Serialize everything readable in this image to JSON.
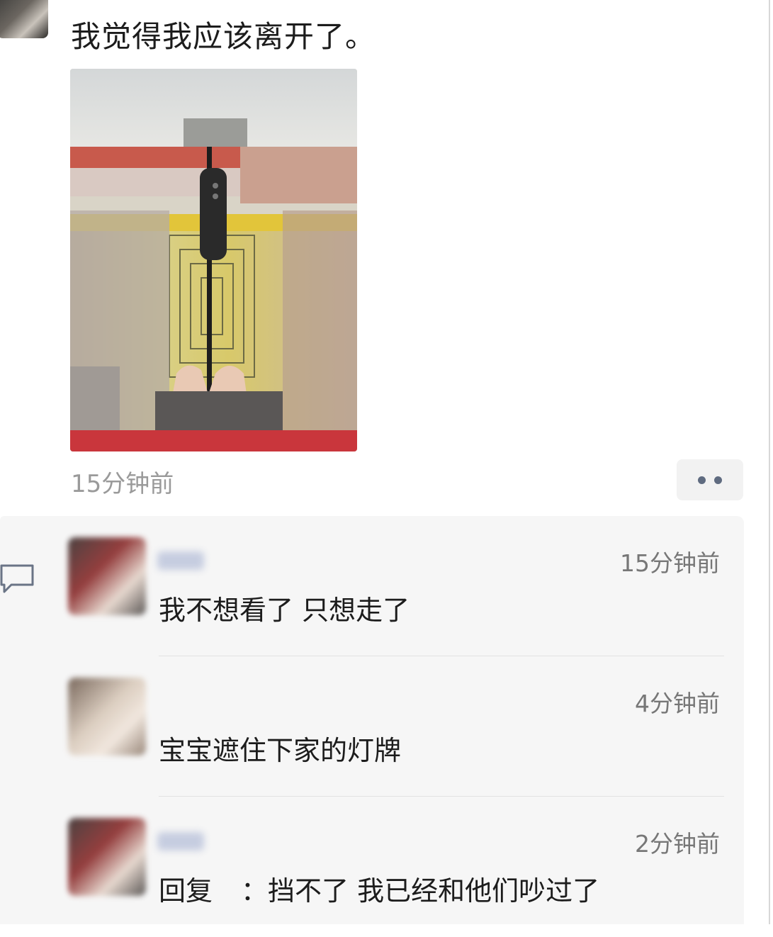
{
  "post": {
    "text": "我觉得我应该离开了。",
    "time": "15分钟前"
  },
  "icons": {
    "more": "more-dots-icon",
    "comment": "comment-bubble-icon"
  },
  "colors": {
    "background": "#ffffff",
    "comment_area": "#f6f6f6",
    "time_text": "#9a9a9a",
    "more_dots": "#5f6b80"
  },
  "comments": [
    {
      "time": "15分钟前",
      "text": "我不想看了 只想走了"
    },
    {
      "time": "4分钟前",
      "text": "宝宝遮住下家的灯牌"
    },
    {
      "time": "2分钟前",
      "reply_prefix": "回复",
      "text": "：挡不了 我已经和他们吵过了"
    }
  ]
}
